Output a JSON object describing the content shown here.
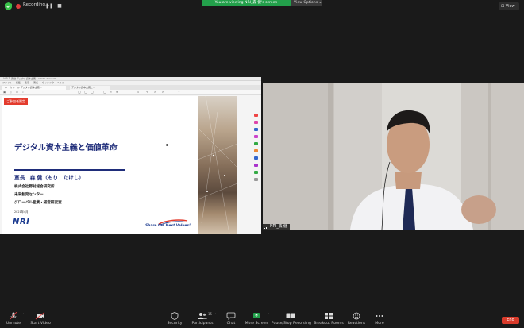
{
  "top_bar": {
    "recording_label": "Recording...",
    "viewing_banner": "You are viewing NRI_森 健's screen",
    "view_options": "View Options",
    "view_button": "View"
  },
  "shared_screen": {
    "window_title": "ＮＲＩ 森健 デジタル資本主義 - Adobe Acrobat",
    "menu": [
      "ファイル",
      "編集",
      "表示",
      "署名",
      "ウィンドウ",
      "ヘルプ"
    ],
    "tab_active": "ホーム  ツール  デジタル資本主義...",
    "tab_secondary": "デジタル資本主義と...",
    "slide": {
      "badge": "ご参加者限定",
      "title": "デジタル資本主義と価値革命",
      "presenter": "室長　森 健（もり　たけし）",
      "org_lines": [
        "株式会社野村総合研究所",
        "未来創発センター",
        "グローバル産業・経営研究室"
      ],
      "date": "2021年4月",
      "logo": "NRI",
      "slogan": "Share the Next Values!"
    }
  },
  "video_tile": {
    "name_tag": "NRI_森 健"
  },
  "toolbar": {
    "unmute": "Unmute",
    "start_video": "Start Video",
    "security": "Security",
    "participants": "Participants",
    "participants_count": "15",
    "chat": "Chat",
    "more_share": "More Screen",
    "pause_recording": "Pause/Stop Recording",
    "breakout_rooms": "Breakout Rooms",
    "reactions": "Reactions",
    "more": "More",
    "end": "End"
  },
  "colors": {
    "zoom_green": "#23a04b",
    "end_red": "#d93b2b",
    "slide_navy": "#1f2d7a",
    "badge_red": "#e33b2d"
  }
}
